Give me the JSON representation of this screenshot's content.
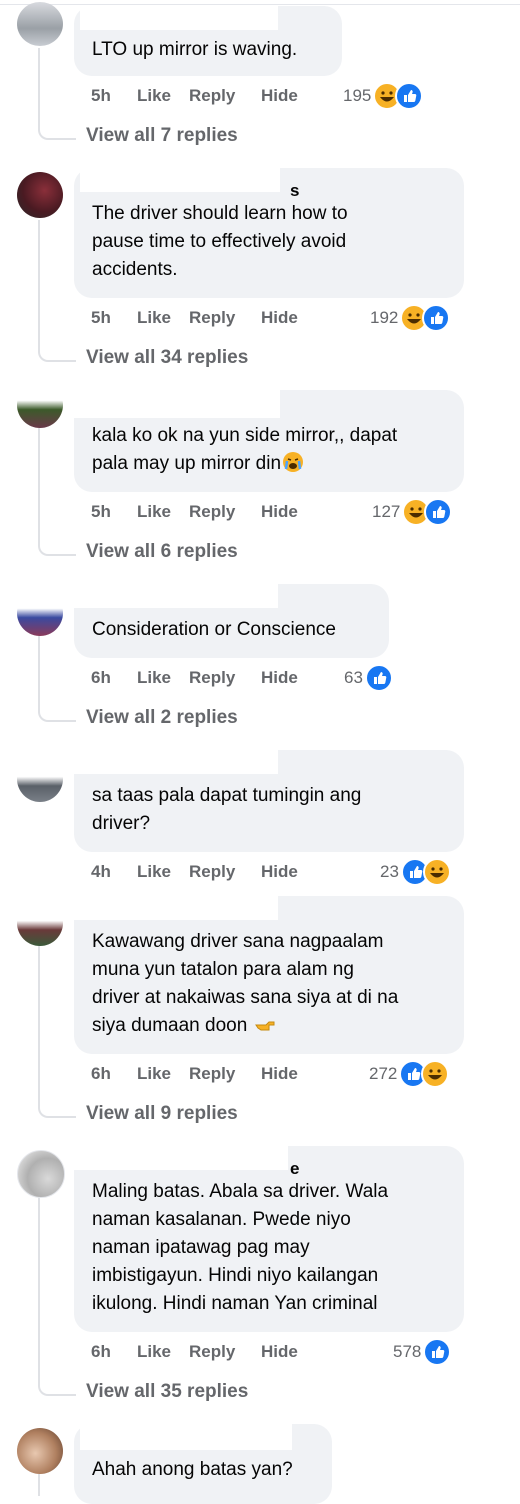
{
  "comments": [
    {
      "text": "LTO up mirror is waving.",
      "name_fragment": "",
      "time": "5h",
      "reactions": {
        "count": "195",
        "icons": [
          "haha",
          "like"
        ]
      },
      "view_replies": "View all 7 replies"
    },
    {
      "text": "The driver should learn how to\npause time to effectively avoid\naccidents.",
      "name_fragment": "s",
      "time": "5h",
      "reactions": {
        "count": "192",
        "icons": [
          "haha",
          "like"
        ]
      },
      "view_replies": "View all 34 replies"
    },
    {
      "text": "kala ko ok na yun side mirror,, dapat\npala may up mirror din",
      "name_fragment": "",
      "time": "5h",
      "reactions": {
        "count": "127",
        "icons": [
          "haha",
          "like"
        ]
      },
      "view_replies": "View all 6 replies"
    },
    {
      "text": "Consideration or Conscience",
      "name_fragment": "",
      "time": "6h",
      "reactions": {
        "count": "63",
        "icons": [
          "like"
        ]
      },
      "view_replies": "View all 2 replies"
    },
    {
      "text": "sa taas pala dapat tumingin ang\ndriver?",
      "name_fragment": "",
      "time": "4h",
      "reactions": {
        "count": "23",
        "icons": [
          "like",
          "haha"
        ]
      },
      "view_replies": ""
    },
    {
      "text": "Kawawang driver sana nagpaalam\nmuna yun tatalon para alam ng\ndriver at nakaiwas sana siya at di na\nsiya dumaan doon",
      "name_fragment": "",
      "time": "6h",
      "reactions": {
        "count": "272",
        "icons": [
          "like",
          "haha"
        ]
      },
      "view_replies": "View all 9 replies"
    },
    {
      "text": "Maling batas. Abala sa driver. Wala\nnaman kasalanan. Pwede niyo\nnaman ipatawag pag may\nimbistigayun. Hindi niyo kailangan\nikulong. Hindi naman Yan criminal",
      "name_fragment": "e",
      "time": "6h",
      "reactions": {
        "count": "578",
        "icons": [
          "like"
        ]
      },
      "view_replies": "View all 35 replies"
    },
    {
      "text": "Ahah anong batas yan?",
      "name_fragment": "",
      "time": "",
      "reactions": {
        "count": "",
        "icons": []
      },
      "view_replies": ""
    }
  ],
  "action_labels": {
    "like": "Like",
    "reply": "Reply",
    "hide": "Hide"
  },
  "colors": {
    "like": "#1877f2",
    "haha": "#f7b125",
    "bubble": "#f0f2f5",
    "meta": "#65676b"
  }
}
